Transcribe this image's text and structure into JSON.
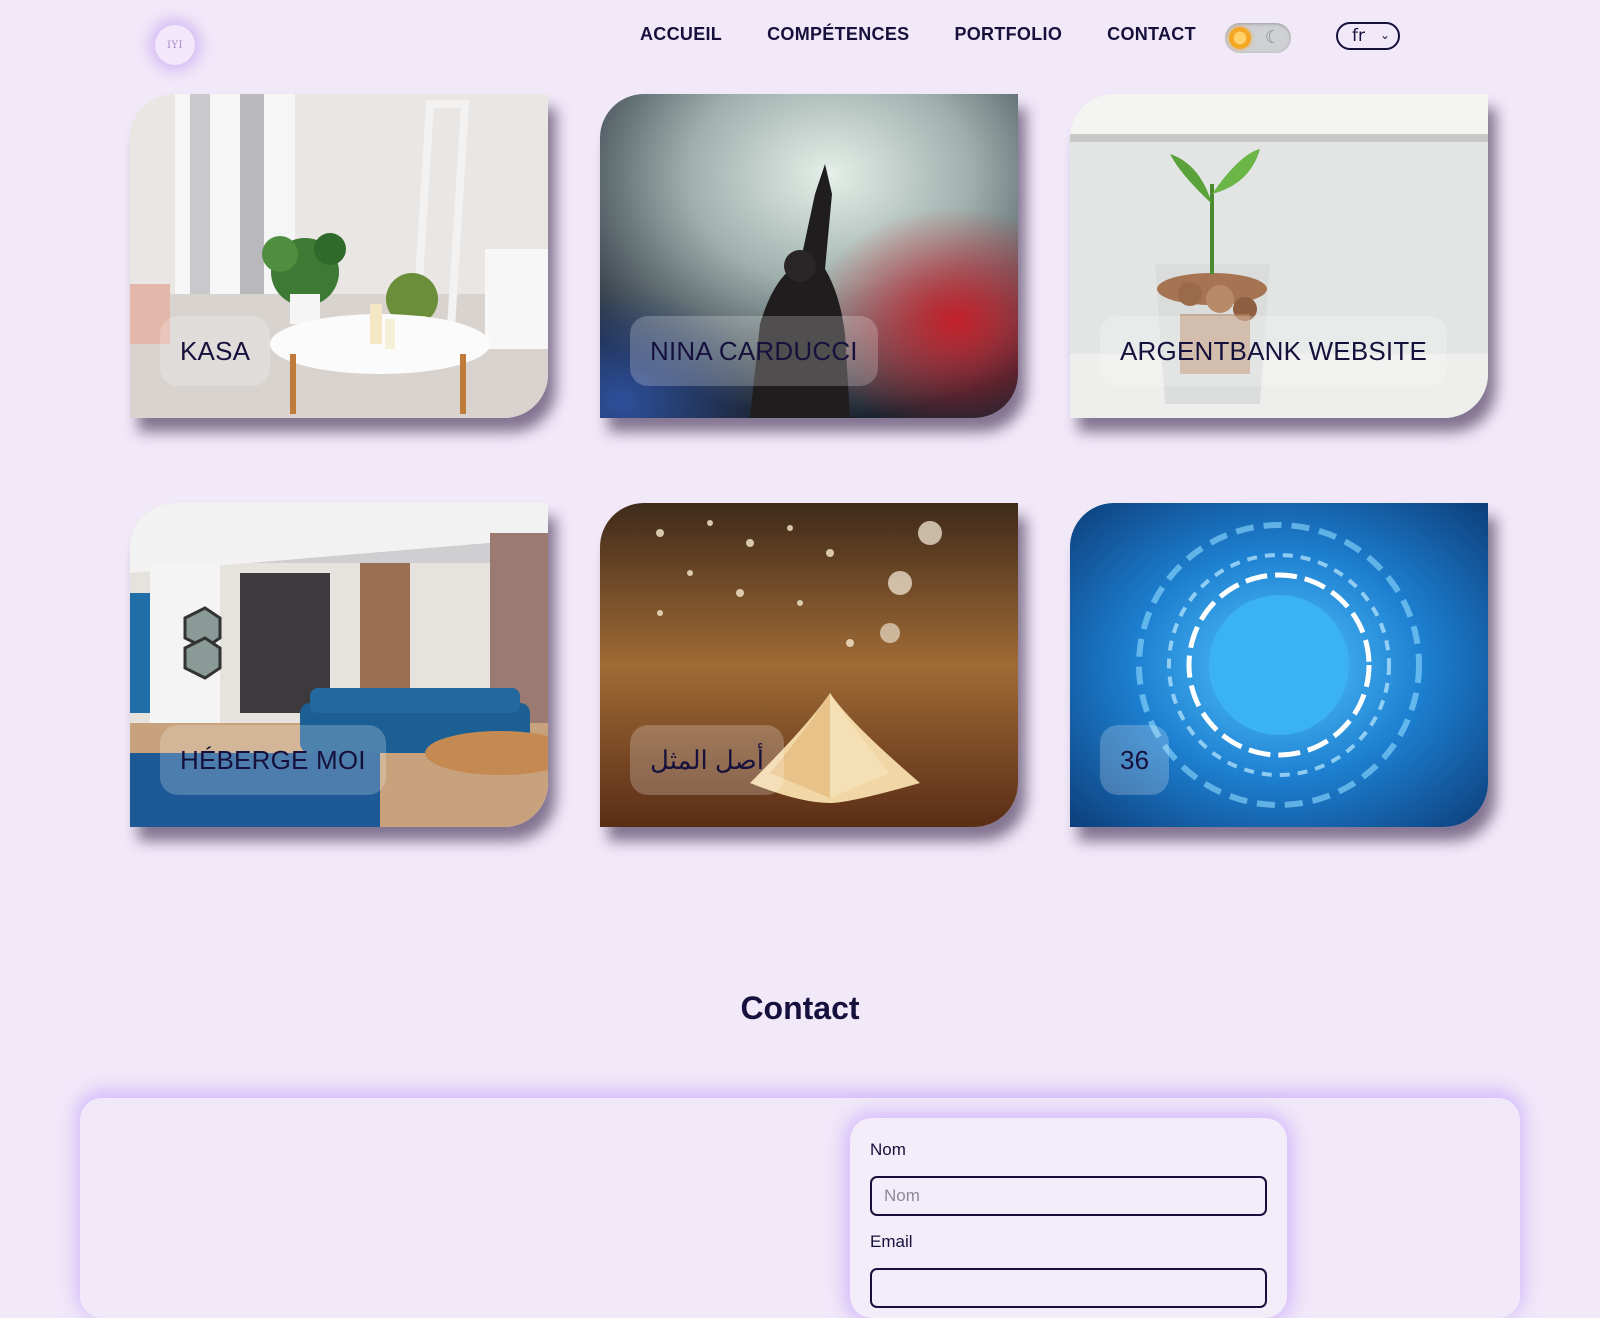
{
  "header": {
    "logo_text": "IYI",
    "nav": [
      {
        "label": "ACCUEIL"
      },
      {
        "label": "COMPÉTENCES"
      },
      {
        "label": "PORTFOLIO"
      },
      {
        "label": "CONTACT"
      }
    ],
    "theme_toggle": {
      "state": "light",
      "icons": [
        "sun-icon",
        "moon-icon"
      ]
    },
    "language_select": {
      "value": "fr"
    }
  },
  "portfolio": {
    "projects": [
      {
        "title": "KASA"
      },
      {
        "title": "NINA CARDUCCI"
      },
      {
        "title": "ARGENTBANK WEBSITE"
      },
      {
        "title": "HÉBERGE MOI"
      },
      {
        "title": "أصل المثل"
      },
      {
        "title": "36"
      }
    ]
  },
  "contact": {
    "title": "Contact",
    "form": {
      "name_label": "Nom",
      "name_placeholder": "Nom",
      "email_label": "Email"
    }
  },
  "colors": {
    "background": "#f1e9f8",
    "text": "#16113c",
    "glow": "#be96ff",
    "toggle_sun": "#f5a623"
  }
}
